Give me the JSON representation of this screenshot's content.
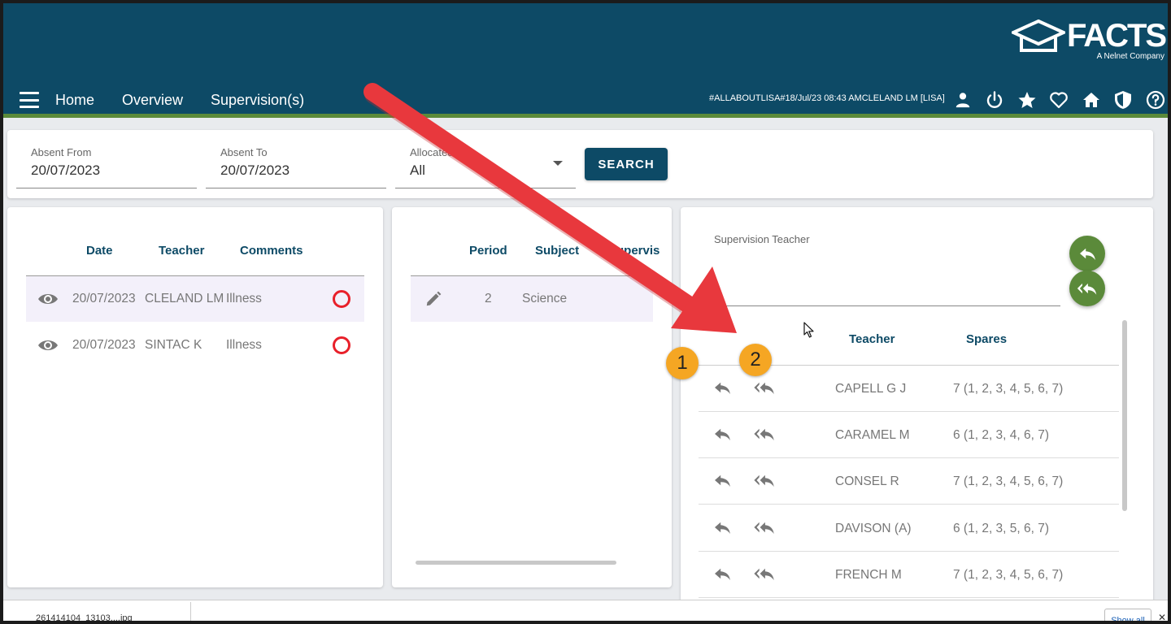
{
  "header": {
    "brand": "FACTS",
    "brand_sub": "A Nelnet Company",
    "nav": [
      "Home",
      "Overview",
      "Supervision(s)"
    ],
    "session_info": "#ALLABOUTLISA#18/Jul/23 08:43 AMCLELAND LM [LISA]",
    "icons": [
      "user-icon",
      "power-icon",
      "star-icon",
      "heart-icon",
      "home-icon",
      "shield-icon",
      "help-icon"
    ]
  },
  "filters": {
    "absent_from_label": "Absent From",
    "absent_from_value": "20/07/2023",
    "absent_to_label": "Absent To",
    "absent_to_value": "20/07/2023",
    "allocated_label": "Allocated",
    "allocated_value": "All",
    "search_label": "SEARCH"
  },
  "absences": {
    "headers": [
      "Date",
      "Teacher",
      "Comments"
    ],
    "rows": [
      {
        "date": "20/07/2023",
        "teacher": "CLELAND LM",
        "comment": "Illness"
      },
      {
        "date": "20/07/2023",
        "teacher": "SINTAC K",
        "comment": "Illness"
      }
    ]
  },
  "periods": {
    "headers": [
      "Period",
      "Subject",
      "Supervis"
    ],
    "rows": [
      {
        "period": "2",
        "subject": "Science"
      }
    ]
  },
  "supervision": {
    "field_label": "Supervision Teacher",
    "headers": [
      "Teacher",
      "Spares"
    ],
    "rows": [
      {
        "teacher": "CAPELL G J",
        "spares": "7 (1, 2, 3, 4, 5, 6, 7)"
      },
      {
        "teacher": "CARAMEL M",
        "spares": "6 (1, 2, 3, 4, 6, 7)"
      },
      {
        "teacher": "CONSEL R",
        "spares": "7 (1, 2, 3, 4, 5, 6, 7)"
      },
      {
        "teacher": "DAVISON (A)",
        "spares": "6 (1, 2, 3, 5, 6, 7)"
      },
      {
        "teacher": "FRENCH M",
        "spares": "7 (1, 2, 3, 4, 5, 6, 7)"
      }
    ]
  },
  "annotations": {
    "badge_1": "1",
    "badge_2": "2",
    "arrow_color": "#e8383d"
  },
  "downloads": {
    "file": "261414104_13103....jpg",
    "show_all": "Show all",
    "close": "✕"
  }
}
